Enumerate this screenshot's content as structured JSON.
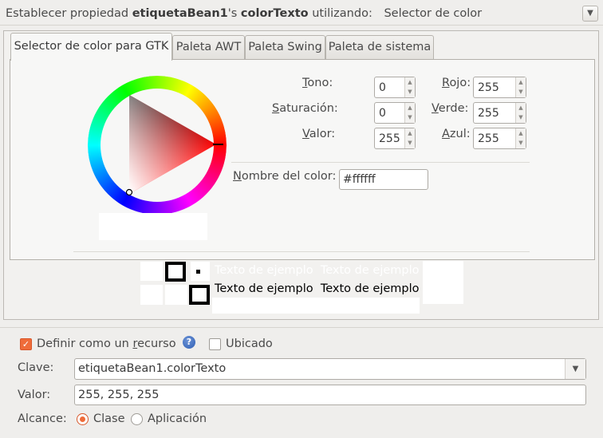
{
  "header": {
    "prefix": "Establecer propiedad",
    "bean": "etiquetaBean1",
    "possessive": "'s",
    "property": "colorTexto",
    "suffix": "utilizando:",
    "selector_label": "Selector de color",
    "dropdown_icon": "chevron-down-icon"
  },
  "tabs": [
    {
      "label": "Selector de color para GTK",
      "active": true
    },
    {
      "label": "Paleta AWT",
      "active": false
    },
    {
      "label": "Paleta Swing",
      "active": false
    },
    {
      "label": "Paleta de sistema",
      "active": false
    }
  ],
  "gtk": {
    "hue_label": "Tono:",
    "hue_mnemonic": "T",
    "hue_rest": "ono:",
    "hue_value": "0",
    "sat_label": "Saturación:",
    "sat_mnemonic": "S",
    "sat_rest": "aturación:",
    "sat_value": "0",
    "val_label": "Valor:",
    "val_mnemonic": "V",
    "val_rest": "alor:",
    "val_value": "255",
    "red_label": "Rojo:",
    "red_mnemonic": "R",
    "red_rest": "ojo:",
    "red_value": "255",
    "green_label": "Verde:",
    "green_mnemonic": "V",
    "green_rest": "erde:",
    "green_value": "255",
    "blue_label": "Azul:",
    "blue_mnemonic": "A",
    "blue_rest": "zul:",
    "blue_value": "255",
    "color_name_label": "Nombre del color:",
    "color_name_mnemonic": "N",
    "color_name_rest": "ombre del color:",
    "color_name_value": "#ffffff",
    "current_color": "#ffffff"
  },
  "preview": {
    "sample_text_1": "Texto de ejemplo",
    "sample_text_2": "Texto de ejemplo",
    "sample_text_3": "Texto de ejemplo",
    "sample_text_4": "Texto de ejemplo",
    "text_color": "#ffffff",
    "text_color_dark": "#000000"
  },
  "resource": {
    "define_label_pre": "Definir como un ",
    "define_label_mnemonic": "r",
    "define_label_post": "ecurso",
    "define_checked": true,
    "help_icon": "help-icon",
    "located_label": "Ubicado",
    "located_checked": false,
    "key_label": "Clave:",
    "key_value": "etiquetaBean1.colorTexto",
    "value_label": "Valor:",
    "value_value": "255, 255, 255",
    "scope_label": "Alcance:",
    "scope_options": [
      "Clase",
      "Aplicación"
    ],
    "scope_selected": "Clase"
  },
  "colors": {
    "accent": "#ef6c3a",
    "hue": "#ff0000"
  }
}
